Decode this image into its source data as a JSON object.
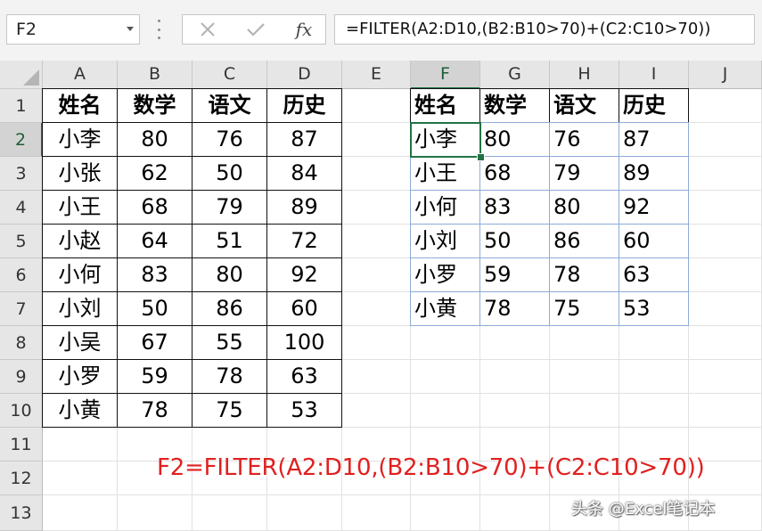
{
  "name_box": {
    "value": "F2"
  },
  "formula_bar": {
    "fx_label": "fx",
    "formula": "=FILTER(A2:D10,(B2:B10>70)+(C2:C10>70))"
  },
  "columns": [
    "A",
    "B",
    "C",
    "D",
    "E",
    "F",
    "G",
    "H",
    "I",
    "J"
  ],
  "rows": [
    "1",
    "2",
    "3",
    "4",
    "5",
    "6",
    "7",
    "8",
    "9",
    "10",
    "11",
    "12",
    "13"
  ],
  "active_cell": "F2",
  "source_table": {
    "headers": [
      "姓名",
      "数学",
      "语文",
      "历史"
    ],
    "rows": [
      [
        "小李",
        "80",
        "76",
        "87"
      ],
      [
        "小张",
        "62",
        "50",
        "84"
      ],
      [
        "小王",
        "68",
        "79",
        "89"
      ],
      [
        "小赵",
        "64",
        "51",
        "72"
      ],
      [
        "小何",
        "83",
        "80",
        "92"
      ],
      [
        "小刘",
        "50",
        "86",
        "60"
      ],
      [
        "小吴",
        "67",
        "55",
        "100"
      ],
      [
        "小罗",
        "59",
        "78",
        "63"
      ],
      [
        "小黄",
        "78",
        "75",
        "53"
      ]
    ]
  },
  "result_table": {
    "headers": [
      "姓名",
      "数学",
      "语文",
      "历史"
    ],
    "rows": [
      [
        "小李",
        "80",
        "76",
        "87"
      ],
      [
        "小王",
        "68",
        "79",
        "89"
      ],
      [
        "小何",
        "83",
        "80",
        "92"
      ],
      [
        "小刘",
        "50",
        "86",
        "60"
      ],
      [
        "小罗",
        "59",
        "78",
        "63"
      ],
      [
        "小黄",
        "78",
        "75",
        "53"
      ]
    ]
  },
  "annotation": "F2=FILTER(A2:D10,(B2:B10>70)+(C2:C10>70))",
  "watermark": "头条 @Excel笔记本",
  "colors": {
    "selection": "#217346",
    "annotation": "#e02020",
    "spill_border": "#8eabd6"
  }
}
